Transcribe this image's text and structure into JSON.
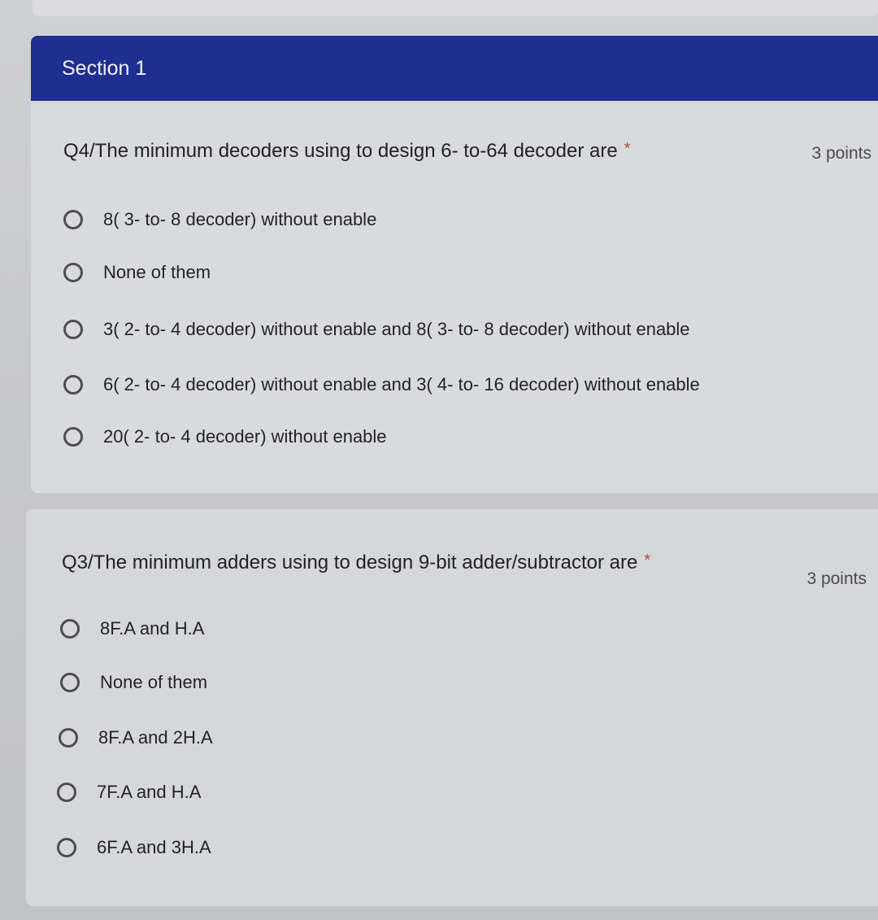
{
  "section": {
    "title": "Section 1"
  },
  "questions": [
    {
      "title": "Q4/The minimum decoders using to design 6- to-64 decoder are",
      "required_mark": "*",
      "points": "3 points",
      "options": [
        "8( 3- to- 8 decoder) without enable",
        "None of them",
        "3( 2- to- 4 decoder) without enable and 8( 3- to- 8 decoder) without enable",
        "6( 2- to- 4 decoder) without enable and 3( 4- to- 16 decoder) without enable",
        "20( 2- to- 4 decoder) without enable"
      ]
    },
    {
      "title": "Q3/The minimum adders using to design 9-bit adder/subtractor are",
      "required_mark": "*",
      "points": "3 points",
      "options": [
        "8F.A and H.A",
        "None of them",
        "8F.A and 2H.A",
        "7F.A and H.A",
        "6F.A and 3H.A"
      ]
    }
  ],
  "colors": {
    "header_bg": "#1f2f91",
    "header_text": "#f2f2f6",
    "required": "#b44b4b"
  }
}
